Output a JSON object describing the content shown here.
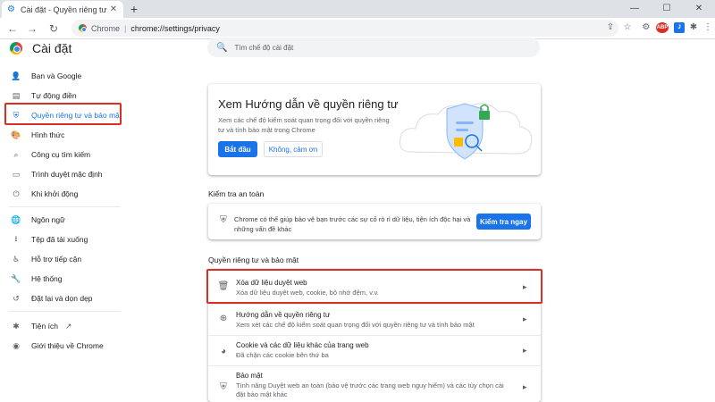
{
  "browser": {
    "tab_title": "Cài đặt - Quyền riêng tư và bảo mật",
    "tab_close": "✕",
    "new_tab": "+",
    "window_controls": [
      "—",
      "☐",
      "✕"
    ],
    "back": "←",
    "forward": "→",
    "reload": "↻",
    "url_brand": "Chrome",
    "url_separator": "|",
    "url": "chrome://settings/privacy",
    "toolbar_icons": [
      "share-icon",
      "star-icon",
      "extension-badge",
      "extension-j",
      "puzzle-icon",
      "profile-icon"
    ],
    "ext_badge_text": "ABP",
    "ext_j_text": "J"
  },
  "header": {
    "title": "Cài đặt",
    "search_placeholder": "Tìm chế độ cài đặt",
    "search_icon": "🔍"
  },
  "sidebar": {
    "items": [
      {
        "label": "Bạn và Google",
        "icon": "person-icon",
        "glyph": "👤"
      },
      {
        "label": "Tự động điền",
        "icon": "autofill-icon",
        "glyph": "▤"
      },
      {
        "label": "Quyền riêng tư và bảo mật",
        "icon": "shield-icon",
        "glyph": "⛨"
      },
      {
        "label": "Hình thức",
        "icon": "palette-icon",
        "glyph": "🎨"
      },
      {
        "label": "Công cụ tìm kiếm",
        "icon": "search-icon",
        "glyph": "⌕"
      },
      {
        "label": "Trình duyệt mặc định",
        "icon": "browser-icon",
        "glyph": "▭"
      },
      {
        "label": "Khi khởi động",
        "icon": "power-icon",
        "glyph": "⏻"
      },
      {
        "label": "Ngôn ngữ",
        "icon": "globe-icon",
        "glyph": "🌐"
      },
      {
        "label": "Tệp đã tải xuống",
        "icon": "download-icon",
        "glyph": "⭳"
      },
      {
        "label": "Hỗ trợ tiếp cận",
        "icon": "accessibility-icon",
        "glyph": "♿"
      },
      {
        "label": "Hệ thống",
        "icon": "wrench-icon",
        "glyph": "🔧"
      },
      {
        "label": "Đặt lại và dọn dẹp",
        "icon": "reset-icon",
        "glyph": "↺"
      },
      {
        "label": "Tiện ích",
        "icon": "extensions-icon",
        "glyph": "✱",
        "ext_link": "↗"
      },
      {
        "label": "Giới thiệu về Chrome",
        "icon": "chrome-icon",
        "glyph": "◉"
      }
    ],
    "active_index": 2
  },
  "privacy_guide": {
    "title": "Xem Hướng dẫn về quyền riêng tư",
    "description": "Xem các chế độ kiểm soát quan trọng đối với quyền riêng tư và tính bảo mật trong Chrome",
    "start_button": "Bắt đầu",
    "no_thanks_button": "Không, cảm ơn"
  },
  "safety_check": {
    "section_title": "Kiểm tra an toàn",
    "text": "Chrome có thể giúp bảo vệ bạn trước các sự cố rò rỉ dữ liệu, tiện ích độc hại và những vấn đề khác",
    "button": "Kiểm tra ngay",
    "icon": "shield-check-icon",
    "glyph": "⛨"
  },
  "privacy_section": {
    "section_title": "Quyền riêng tư và bảo mật",
    "rows": [
      {
        "title": "Xóa dữ liệu duyệt web",
        "subtitle": "Xóa dữ liệu duyệt web, cookie, bộ nhớ đệm, v.v.",
        "icon": "trash-icon",
        "glyph": "🗑"
      },
      {
        "title": "Hướng dẫn về quyền riêng tư",
        "subtitle": "Xem xét các chế độ kiểm soát quan trọng đối với quyền riêng tư và tính bảo mật",
        "icon": "compass-icon",
        "glyph": "⊕"
      },
      {
        "title": "Cookie và các dữ liệu khác của trang web",
        "subtitle": "Đã chặn các cookie bên thứ ba",
        "icon": "cookie-icon",
        "glyph": "◕"
      },
      {
        "title": "Bảo mật",
        "subtitle": "Tính năng Duyệt web an toàn (bảo vệ trước các trang web nguy hiểm) và các tùy chọn cài đặt bảo mật khác",
        "icon": "security-icon",
        "glyph": "⛨"
      }
    ],
    "arrow": "▸"
  },
  "colors": {
    "accent": "#1a73e8",
    "highlight": "#d93025"
  }
}
